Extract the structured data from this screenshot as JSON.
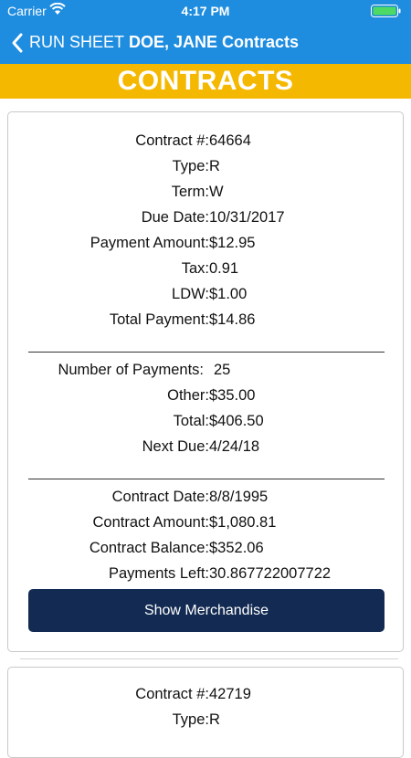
{
  "status_bar": {
    "carrier": "Carrier",
    "time": "4:17 PM"
  },
  "nav": {
    "back_label": "RUN SHEET",
    "title": "DOE, JANE Contracts"
  },
  "banner": {
    "title": "CONTRACTS"
  },
  "colors": {
    "nav_bg": "#1f8ddf",
    "banner_bg": "#f5b800",
    "button_bg": "#132b52",
    "battery": "#4cd964"
  },
  "contracts": [
    {
      "contract_number": {
        "label": "Contract #:",
        "value": "64664"
      },
      "type": {
        "label": "Type:",
        "value": "R"
      },
      "term": {
        "label": "Term:",
        "value": "W"
      },
      "due_date": {
        "label": "Due Date:",
        "value": "10/31/2017"
      },
      "payment_amount": {
        "label": "Payment Amount:",
        "value": "$12.95"
      },
      "tax": {
        "label": "Tax:",
        "value": "0.91"
      },
      "ldw": {
        "label": "LDW:",
        "value": "$1.00"
      },
      "total_payment": {
        "label": "Total Payment:",
        "value": "$14.86"
      },
      "number_of_payments": {
        "label": "Number of Payments:",
        "value": "25"
      },
      "other": {
        "label": "Other:",
        "value": "$35.00"
      },
      "total": {
        "label": "Total:",
        "value": "$406.50"
      },
      "next_due": {
        "label": "Next Due:",
        "value": "4/24/18"
      },
      "contract_date": {
        "label": "Contract Date:",
        "value": "8/8/1995"
      },
      "contract_amount": {
        "label": "Contract Amount:",
        "value": "$1,080.81"
      },
      "contract_balance": {
        "label": "Contract Balance:",
        "value": "$352.06"
      },
      "payments_left": {
        "label": "Payments Left:",
        "value": "30.867722007722"
      },
      "button_label": "Show Merchandise"
    },
    {
      "contract_number": {
        "label": "Contract #:",
        "value": "42719"
      },
      "type": {
        "label": "Type:",
        "value": "R"
      }
    }
  ]
}
